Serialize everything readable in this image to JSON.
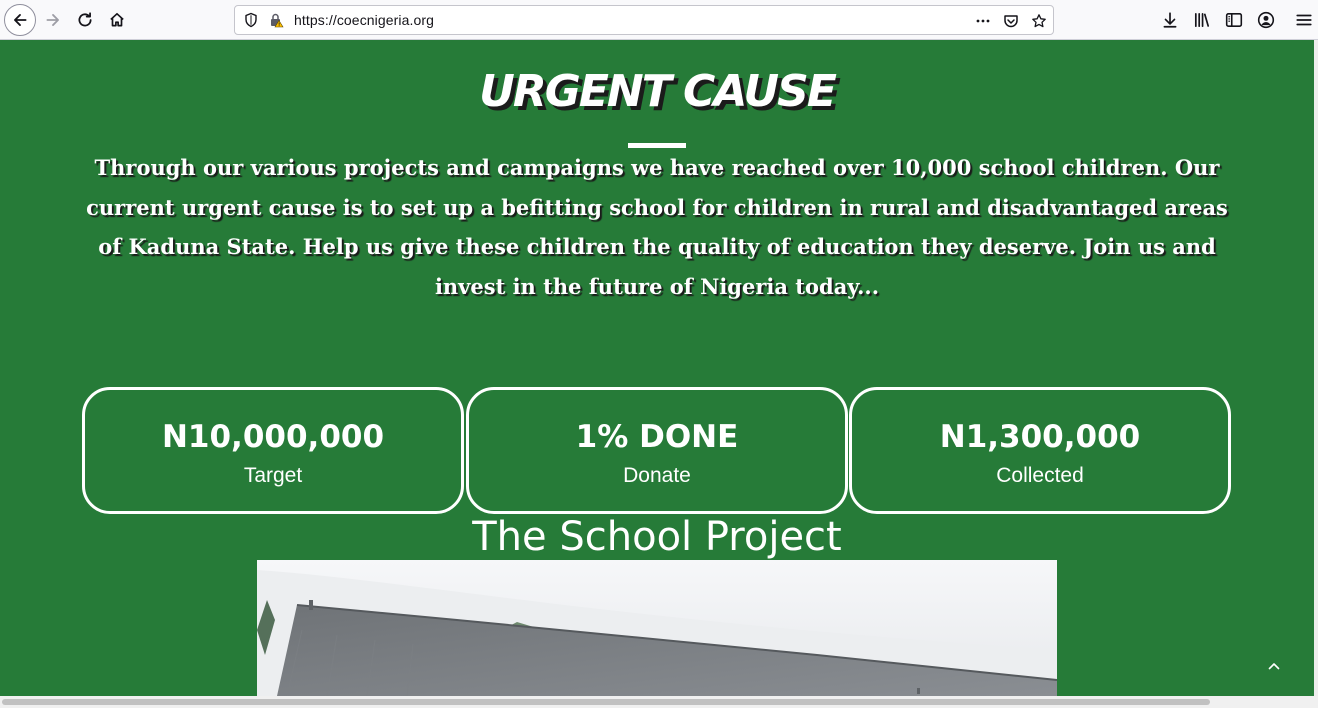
{
  "browser": {
    "url": "https://coecnigeria.org",
    "icons": {
      "back": "back-arrow-icon",
      "forward": "forward-arrow-icon",
      "reload": "reload-icon",
      "home": "home-icon",
      "tracking": "shield-icon",
      "security": "insecure-lock-icon",
      "page_actions": "more-horizontal-icon",
      "pocket": "pocket-icon",
      "bookmark": "star-icon",
      "downloads": "download-icon",
      "library": "library-icon",
      "sidebar": "sidebar-icon",
      "account": "account-icon",
      "menu": "hamburger-menu-icon"
    }
  },
  "page": {
    "colors": {
      "background": "#267b38",
      "text": "#ffffff"
    },
    "section_heading": "URGENT CAUSE",
    "intro_text": "Through our various projects and campaigns we have reached over 10,000 school children. Our current urgent cause is to set up a befitting school for children in rural and disadvantaged areas of Kaduna State. Help us give these children the quality of education they deserve. Join us and invest in the future of Nigeria today...",
    "stats": [
      {
        "value": "N10,000,000",
        "label": "Target"
      },
      {
        "value": "1% DONE",
        "label": "Donate"
      },
      {
        "value": "N1,300,000",
        "label": "Collected"
      }
    ],
    "project_title": "The School Project",
    "scroll_top_icon": "chevron-up-icon"
  }
}
